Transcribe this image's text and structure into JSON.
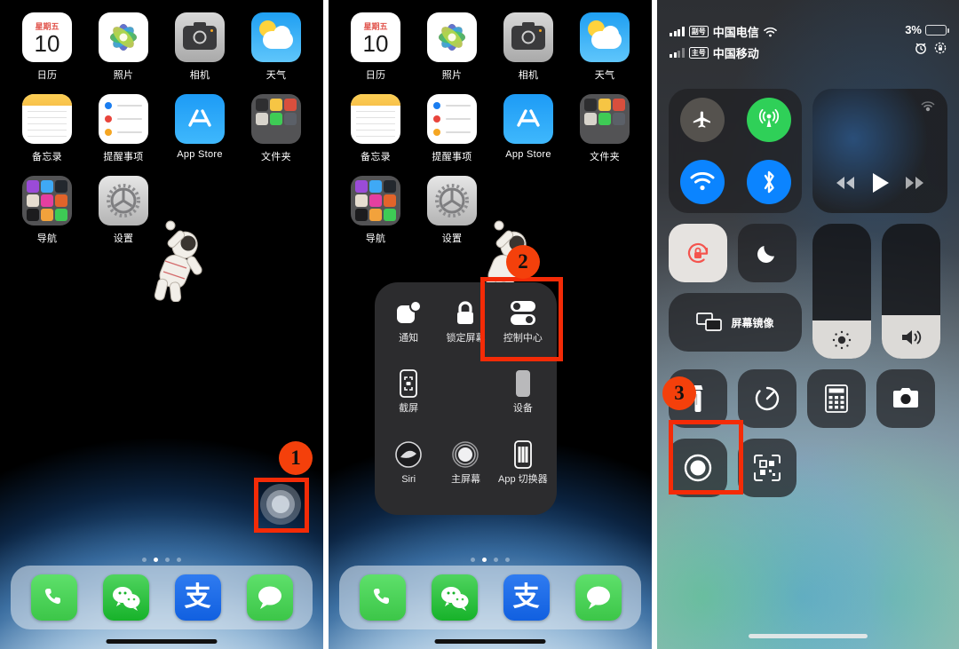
{
  "panels": [
    {
      "id": "panel-home-assistivetouch",
      "step": "1"
    },
    {
      "id": "panel-assistivetouch-menu",
      "step": "2"
    },
    {
      "id": "panel-control-center",
      "step": "3"
    }
  ],
  "home": {
    "calendar": {
      "weekday": "星期五",
      "day": "10"
    },
    "apps_row1": [
      {
        "name": "日历",
        "icon": "calendar-icon"
      },
      {
        "name": "照片",
        "icon": "photos-icon"
      },
      {
        "name": "相机",
        "icon": "camera-icon"
      },
      {
        "name": "天气",
        "icon": "weather-icon"
      }
    ],
    "apps_row2": [
      {
        "name": "备忘录",
        "icon": "notes-icon"
      },
      {
        "name": "提醒事项",
        "icon": "reminders-icon"
      },
      {
        "name": "App Store",
        "icon": "appstore-icon"
      },
      {
        "name": "文件夹",
        "icon": "folder-icon"
      }
    ],
    "apps_row3": [
      {
        "name": "导航",
        "icon": "navigation-folder-icon"
      },
      {
        "name": "设置",
        "icon": "settings-icon"
      }
    ],
    "dock": [
      {
        "name": "电话",
        "icon": "phone-icon"
      },
      {
        "name": "微信",
        "icon": "wechat-icon"
      },
      {
        "name": "支付宝",
        "icon": "alipay-icon",
        "glyph": "支"
      },
      {
        "name": "信息",
        "icon": "messages-icon"
      }
    ],
    "page_dots": {
      "count": 4,
      "active_index": 1
    }
  },
  "assistive_menu": {
    "items": [
      {
        "label": "通知",
        "icon": "notifications-icon",
        "highlighted": false
      },
      {
        "label": "锁定屏幕",
        "icon": "lock-screen-icon",
        "highlighted": false
      },
      {
        "label": "控制中心",
        "icon": "control-center-icon",
        "highlighted": true
      },
      {
        "label": "截屏",
        "icon": "screenshot-icon",
        "highlighted": false
      },
      {
        "label": "",
        "icon": "none",
        "highlighted": false
      },
      {
        "label": "设备",
        "icon": "device-icon",
        "highlighted": false
      },
      {
        "label": "Siri",
        "icon": "siri-icon",
        "highlighted": false
      },
      {
        "label": "主屏幕",
        "icon": "home-icon",
        "highlighted": false
      },
      {
        "label": "App 切换器",
        "icon": "app-switcher-icon",
        "highlighted": false
      }
    ]
  },
  "control_center": {
    "status_bar": {
      "line1": {
        "tag": "副号",
        "carrier": "中国电信",
        "signal_bars": 4,
        "wifi": true
      },
      "line2": {
        "tag": "主号",
        "carrier": "中国移动",
        "signal_bars": 2
      },
      "battery_percent": "3%",
      "battery_level": 12,
      "icons": [
        "alarm-icon",
        "rotation-lock-icon"
      ]
    },
    "connectivity": [
      {
        "name": "airplane-mode",
        "state": "off"
      },
      {
        "name": "cellular-data",
        "state": "on"
      },
      {
        "name": "wifi",
        "state": "on"
      },
      {
        "name": "bluetooth",
        "state": "on"
      }
    ],
    "media": {
      "airplay": "airplay-icon",
      "controls": [
        "rewind",
        "play",
        "fast-forward"
      ]
    },
    "rotation_lock": {
      "state": "on"
    },
    "do_not_disturb": {
      "state": "off"
    },
    "screen_mirroring": {
      "label": "屏幕镜像"
    },
    "brightness": {
      "value": 28
    },
    "volume": {
      "value": 32
    },
    "tiles": [
      {
        "name": "flashlight",
        "icon": "flashlight-icon"
      },
      {
        "name": "timer",
        "icon": "timer-icon"
      },
      {
        "name": "calculator",
        "icon": "calculator-icon"
      },
      {
        "name": "camera",
        "icon": "camera-icon"
      },
      {
        "name": "screen-recording",
        "icon": "screen-record-icon",
        "highlighted": true
      },
      {
        "name": "qr-scanner",
        "icon": "qr-code-icon"
      }
    ]
  },
  "annotations": {
    "colors": {
      "highlight": "#f42b07",
      "badge": "#f4400b"
    },
    "steps": [
      {
        "number": "1",
        "target": "assistive-touch-button"
      },
      {
        "number": "2",
        "target": "control-center-menu-item"
      },
      {
        "number": "3",
        "target": "screen-recording-tile"
      }
    ]
  }
}
